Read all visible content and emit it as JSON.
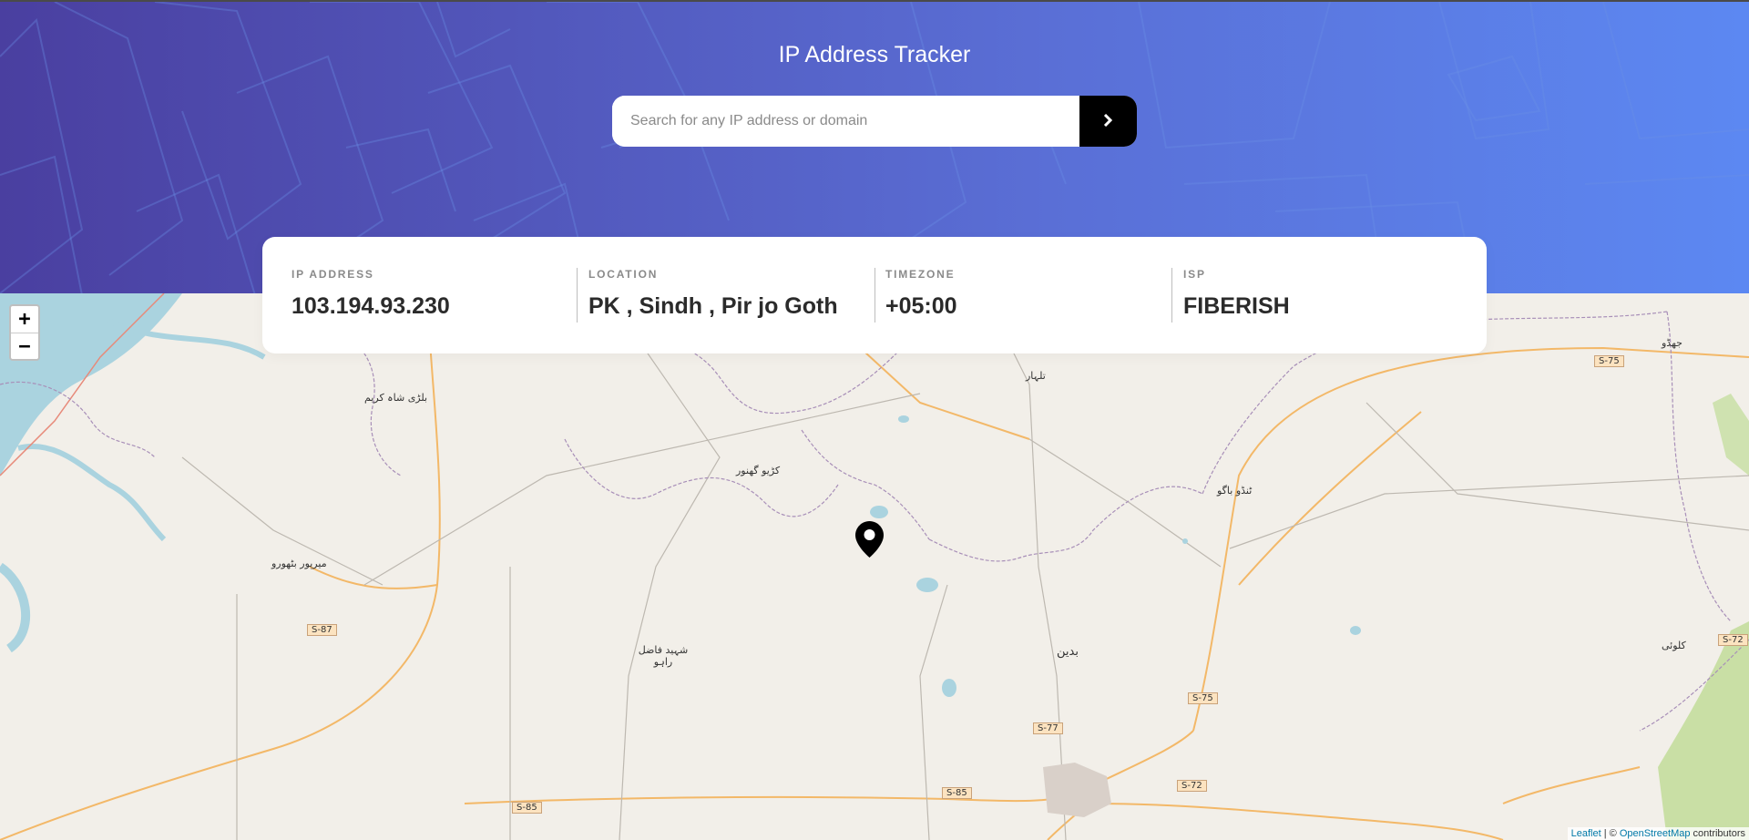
{
  "header": {
    "title": "IP Address Tracker",
    "search_placeholder": "Search for any IP address or domain",
    "search_value": "",
    "submit_icon": "chevron-right-icon"
  },
  "info": {
    "ip_label": "IP ADDRESS",
    "ip_value": "103.194.93.230",
    "location_label": "LOCATION",
    "location_value": "PK , Sindh , Pir jo Goth",
    "timezone_label": "TIMEZONE",
    "timezone_value": "+05:00",
    "isp_label": "ISP",
    "isp_value": "FIBERISH"
  },
  "map": {
    "zoom_in": "+",
    "zoom_out": "−",
    "attribution_leaflet": "Leaflet",
    "attribution_sep": " | © ",
    "attribution_osm": "OpenStreetMap",
    "attribution_suffix": " contributors",
    "marker_icon": "location-pin-icon",
    "place_labels": [
      "بلڑی شاہ کریم",
      "میرپور بٹھورو",
      "کڑیو گھنور",
      "ٹنڈو باگو",
      "تلہار",
      "بدین",
      "شہید فاضل راہو",
      "جھڈو",
      "کلوئی"
    ],
    "road_labels": [
      "S-87",
      "S-85",
      "S-85",
      "S-77",
      "S-75",
      "S-75",
      "S-72",
      "S-72"
    ]
  },
  "colors": {
    "accent": "#000000",
    "header_start": "#4a3fa0",
    "header_end": "#5c88f2",
    "text_dark": "#2b2b2b",
    "text_muted": "#8a8a8a"
  }
}
